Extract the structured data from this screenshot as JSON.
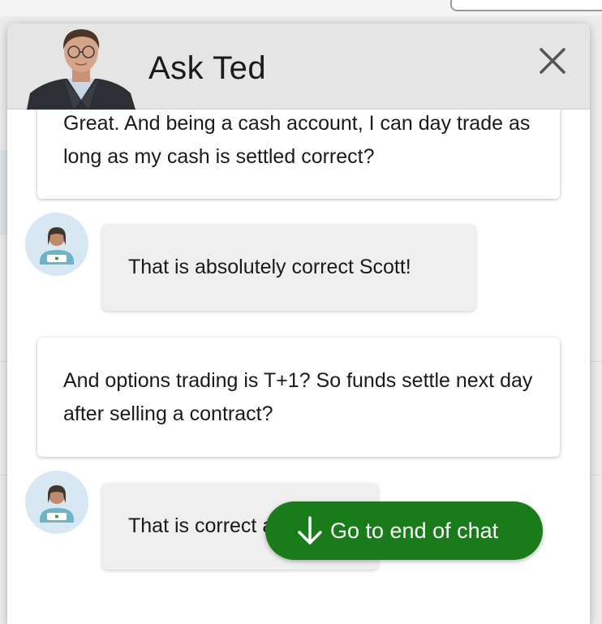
{
  "chat": {
    "title": "Ask Ted",
    "messages": [
      {
        "sender": "user",
        "text": "Great. And being a cash account, I can day trade as long as my cash is settled correct?"
      },
      {
        "sender": "agent",
        "text": "That is absolutely correct Scott!"
      },
      {
        "sender": "user",
        "text": "And options trading is T+1? So funds settle next day after selling a contract?"
      },
      {
        "sender": "agent",
        "text": "That is correct as well!"
      }
    ],
    "go_to_end_label": "Go to end of chat"
  },
  "colors": {
    "header_bg": "#e5e5e5",
    "go_to_end_button": "#1a7b1b",
    "agent_bubble_bg": "#efefef",
    "user_bubble_bg": "#ffffff"
  },
  "icons": [
    "ted-avatar",
    "close-icon",
    "agent-avatar-icon",
    "arrow-down-icon"
  ]
}
